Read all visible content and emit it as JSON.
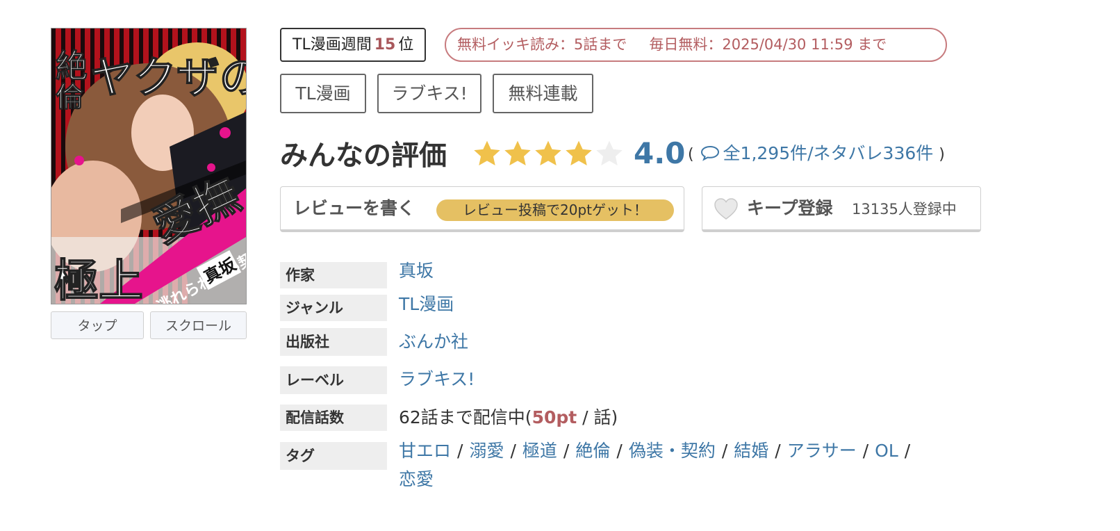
{
  "cover": {
    "buttons": {
      "tap": "タップ",
      "scroll": "スクロール"
    }
  },
  "rank": {
    "prefix": "TL漫画週間",
    "number": "15",
    "suffix": "位"
  },
  "free_info": {
    "ikki": "無料イッキ読み：5話まで",
    "daily": "毎日無料：2025/04/30 11:59 まで"
  },
  "genre_tags": [
    "TL漫画",
    "ラブキス!",
    "無料連載"
  ],
  "rating": {
    "title": "みんなの評価",
    "value": 4.0,
    "value_display": "4.0",
    "stars_filled": 4,
    "stars_total": 5,
    "reviews": {
      "open": "(",
      "text": "全1,295件/ネタバレ336件",
      "close": ")"
    }
  },
  "actions": {
    "review_label": "レビューを書く",
    "review_promo": "レビュー投稿で20ptゲット！",
    "keep_label": "キープ登録",
    "keep_count": "13135人登録中"
  },
  "info": {
    "author_label": "作家",
    "author": "真坂",
    "genre_label": "ジャンル",
    "genre": "TL漫画",
    "publisher_label": "出版社",
    "publisher": "ぶんか社",
    "label_label": "レーベル",
    "label": "ラブキス!",
    "episodes_label": "配信話数",
    "episodes_text": "62話まで配信中(",
    "episodes_price": "50pt",
    "episodes_unit": " / 話)",
    "tags_label": "タグ",
    "tags": [
      "甘エロ",
      "溺愛",
      "極道",
      "絶倫",
      "偽装・契約",
      "結婚",
      "アラサー",
      "OL",
      "恋愛"
    ]
  },
  "colors": {
    "link": "#3e77a6",
    "star_filled": "#f0c14b",
    "star_empty": "#eeeeee",
    "promo_bg": "#e5c063",
    "free_pill": "#b35d60"
  }
}
